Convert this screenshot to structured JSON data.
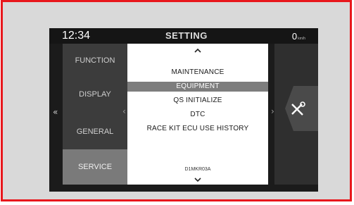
{
  "status": {
    "time": "12:34",
    "title": "SETTING",
    "speed_value": "0",
    "speed_unit": "km/h"
  },
  "categories": [
    {
      "label": "FUNCTION",
      "active": false
    },
    {
      "label": "DISPLAY",
      "active": false
    },
    {
      "label": "GENERAL",
      "active": false
    },
    {
      "label": "SERVICE",
      "active": true
    }
  ],
  "menu": {
    "items": [
      {
        "label": "MAINTENANCE",
        "selected": false
      },
      {
        "label": "EQUIPMENT",
        "selected": true
      },
      {
        "label": "QS INITIALIZE",
        "selected": false
      },
      {
        "label": "DTC",
        "selected": false
      },
      {
        "label": "RACE KIT ECU USE HISTORY",
        "selected": false
      }
    ],
    "code": "D1MKR03A"
  },
  "nav": {
    "left_glyph": "«",
    "chev_left": "‹",
    "chev_right": "›",
    "up_glyph": "⌃",
    "down_glyph": "⌄"
  },
  "icons": {
    "right_panel": "tools-icon"
  },
  "colors": {
    "frame_border": "#e8171c",
    "selected_bg": "#7d7d7d"
  }
}
